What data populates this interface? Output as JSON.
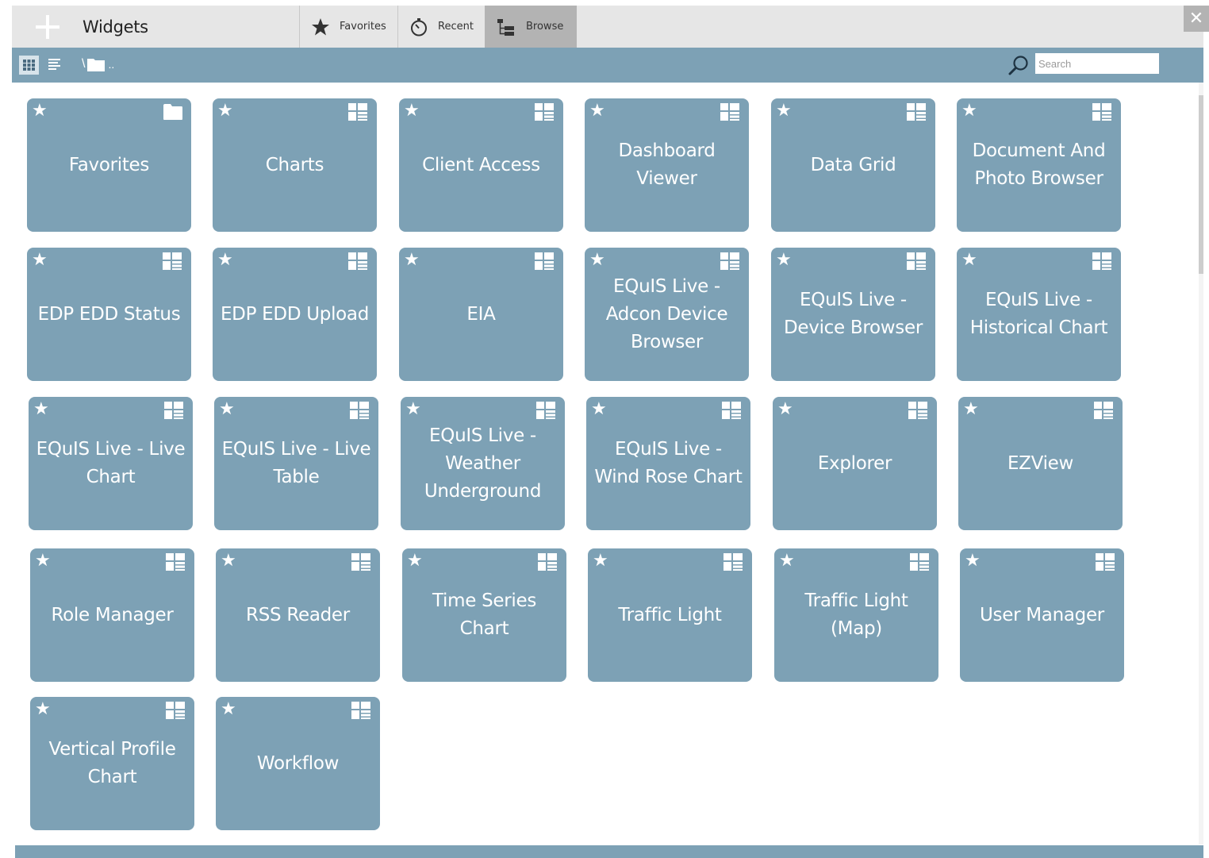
{
  "header": {
    "title": "Widgets",
    "tabs": [
      {
        "label": "Favorites",
        "icon": "star-icon",
        "selected": false
      },
      {
        "label": "Recent",
        "icon": "stopwatch-icon",
        "selected": false
      },
      {
        "label": "Browse",
        "icon": "tree-icon",
        "selected": true
      }
    ],
    "close_label": "✕"
  },
  "toolbar": {
    "breadcrumb_separator": "\\",
    "breadcrumb_trail": "..",
    "search": {
      "placeholder": "Search",
      "value": ""
    }
  },
  "colors": {
    "tile": "#7da1b5",
    "header": "#e6e6e6",
    "selected_tab": "#b3b3b3"
  },
  "tiles": [
    {
      "label": "Favorites",
      "icon": "folder-icon"
    },
    {
      "label": "Charts",
      "icon": "widget-icon"
    },
    {
      "label": "Client Access",
      "icon": "widget-icon"
    },
    {
      "label": "Dashboard Viewer",
      "icon": "widget-icon"
    },
    {
      "label": "Data Grid",
      "icon": "widget-icon"
    },
    {
      "label": "Document And Photo Browser",
      "icon": "widget-icon"
    },
    {
      "label": "EDP EDD Status",
      "icon": "widget-icon"
    },
    {
      "label": "EDP EDD Upload",
      "icon": "widget-icon"
    },
    {
      "label": "EIA",
      "icon": "widget-icon"
    },
    {
      "label": "EQuIS Live - Adcon Device Browser",
      "icon": "widget-icon"
    },
    {
      "label": "EQuIS Live - Device Browser",
      "icon": "widget-icon"
    },
    {
      "label": "EQuIS Live - Historical Chart",
      "icon": "widget-icon"
    },
    {
      "label": "EQuIS Live - Live Chart",
      "icon": "widget-icon"
    },
    {
      "label": "EQuIS Live - Live Table",
      "icon": "widget-icon"
    },
    {
      "label": "EQuIS Live - Weather Underground",
      "icon": "widget-icon"
    },
    {
      "label": "EQuIS Live - Wind Rose Chart",
      "icon": "widget-icon"
    },
    {
      "label": "Explorer",
      "icon": "widget-icon"
    },
    {
      "label": "EZView",
      "icon": "widget-icon"
    },
    {
      "label": "Role Manager",
      "icon": "widget-icon"
    },
    {
      "label": "RSS Reader",
      "icon": "widget-icon"
    },
    {
      "label": "Time Series Chart",
      "icon": "widget-icon"
    },
    {
      "label": "Traffic Light",
      "icon": "widget-icon"
    },
    {
      "label": "Traffic Light (Map)",
      "icon": "widget-icon"
    },
    {
      "label": "User Manager",
      "icon": "widget-icon"
    },
    {
      "label": "Vertical Profile Chart",
      "icon": "widget-icon"
    },
    {
      "label": "Workflow",
      "icon": "widget-icon"
    }
  ]
}
